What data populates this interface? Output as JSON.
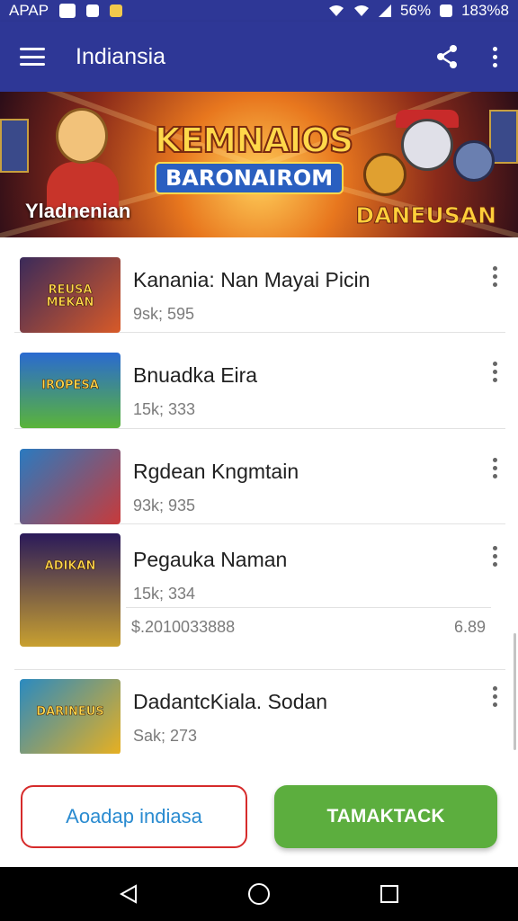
{
  "status_bar": {
    "left_text": "APAP",
    "battery_text": "56%",
    "time_text": "183%8"
  },
  "app_bar": {
    "title": "Indiansia",
    "menu_icon": "hamburger-menu-icon",
    "share_icon": "share-icon",
    "overflow_icon": "more-vertical-icon"
  },
  "banner": {
    "logo_top": "KEMNAIOS",
    "logo_bottom": "BARONAIROM",
    "left_label": "Yladnenian",
    "right_label": "DANEUSAN"
  },
  "games": [
    {
      "title": "Kanania: Nan Mayai Picin",
      "subtitle": "9sk; 595",
      "thumb_text": "REUSA MEKAN",
      "thumb_colors": [
        "#3a2a5a",
        "#d85a28"
      ]
    },
    {
      "title": "Bnuadka Eira",
      "subtitle": "15k; 333",
      "thumb_text": "IROPESA",
      "thumb_colors": [
        "#2a6ad0",
        "#5ab43a"
      ]
    },
    {
      "title": "Rgdean Kngmtain",
      "subtitle": "93k; 935",
      "thumb_text": "",
      "thumb_colors": [
        "#2a7ac0",
        "#c83a3a"
      ]
    },
    {
      "title": "Pegauka Naman",
      "subtitle": "15k; 334",
      "thumb_text": "ADIKAN",
      "thumb_colors": [
        "#2a1a5a",
        "#c8a030"
      ],
      "extra_left": "$.2010033888",
      "extra_right": "6.89"
    },
    {
      "title": "DadantcKiala. Sodan",
      "subtitle": "Sak; 273",
      "thumb_text": "DARINEUS",
      "thumb_colors": [
        "#2a8ac0",
        "#e8b020"
      ]
    }
  ],
  "buttons": {
    "secondary_label": "Aoadap indiasa",
    "primary_label": "TAMAKTACK"
  },
  "nav": {
    "back_icon": "back-triangle-icon",
    "home_icon": "home-circle-icon",
    "recents_icon": "recents-square-icon"
  },
  "colors": {
    "app_bar": "#2e3796",
    "primary_button": "#5cae3e",
    "secondary_border": "#d62b2b",
    "secondary_text": "#2a8bd0"
  }
}
